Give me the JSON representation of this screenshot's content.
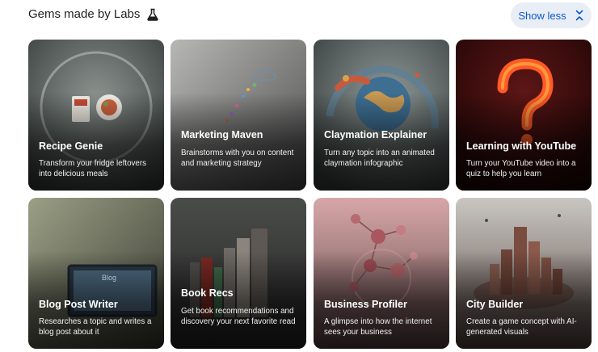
{
  "header": {
    "title": "Gems made by Labs",
    "title_icon": "flask-icon",
    "toggle_label": "Show less",
    "toggle_icon": "chevron-collapse-icon"
  },
  "gems": [
    {
      "title": "Recipe Genie",
      "description": "Transform your fridge leftovers into delicious meals"
    },
    {
      "title": "Marketing Maven",
      "description": "Brainstorms with you on content and marketing strategy"
    },
    {
      "title": "Claymation Explainer",
      "description": "Turn any topic into an animated claymation infographic"
    },
    {
      "title": "Learning with YouTube",
      "description": "Turn your YouTube video into a quiz to help you learn"
    },
    {
      "title": "Blog Post Writer",
      "description": "Researches a topic and writes a blog post about it",
      "screen_text": "Blog"
    },
    {
      "title": "Book Recs",
      "description": "Get book recommendations and discovery your next favorite read"
    },
    {
      "title": "Business Profiler",
      "description": "A glimpse into how the internet sees your business"
    },
    {
      "title": "City Builder",
      "description": "Create a game concept with AI-generated visuals"
    }
  ]
}
